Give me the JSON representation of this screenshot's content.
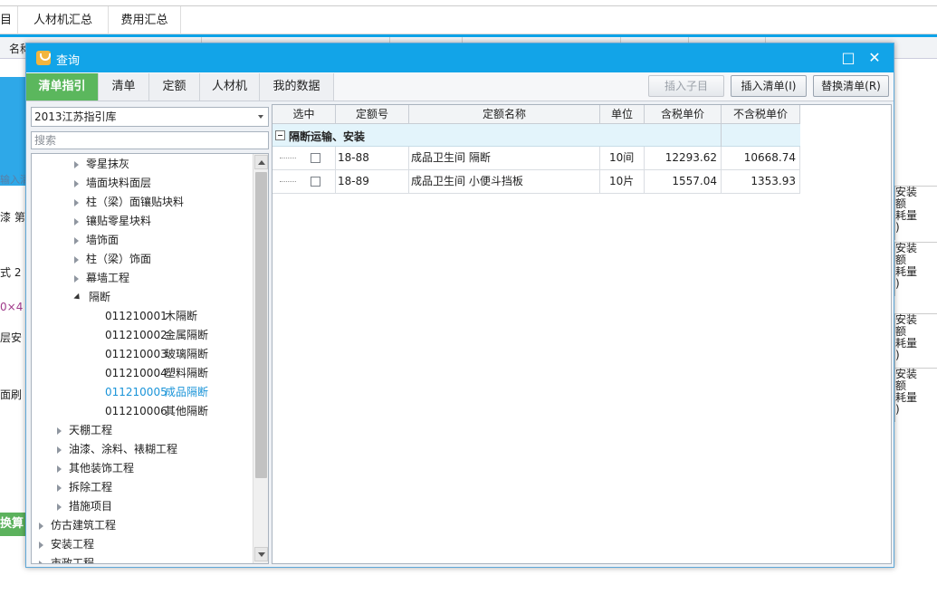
{
  "background": {
    "tabs": [
      "目",
      "人材机汇总",
      "费用汇总"
    ],
    "header_col": "名称",
    "side_texts": [
      "输入清",
      "漆 第",
      "式 2",
      "0×4",
      "层安",
      "面刷",
      "换算"
    ],
    "right_cell": "安装\n额\n耗量\n)"
  },
  "dialog": {
    "title": "查询",
    "tabs": [
      "清单指引",
      "清单",
      "定额",
      "人材机",
      "我的数据"
    ],
    "buttons": {
      "insert_child": "插入子目",
      "insert_list": "插入清单(I)",
      "replace_list": "替换清单(R)"
    },
    "library_select": "2013江苏指引库",
    "search_placeholder": "搜索",
    "tree": [
      {
        "label": "零星抹灰",
        "level": 3,
        "state": "collapsed"
      },
      {
        "label": "墙面块料面层",
        "level": 3,
        "state": "collapsed"
      },
      {
        "label": "柱（梁）面镶贴块料",
        "level": 3,
        "state": "collapsed"
      },
      {
        "label": "镶贴零星块料",
        "level": 3,
        "state": "collapsed"
      },
      {
        "label": "墙饰面",
        "level": 3,
        "state": "collapsed"
      },
      {
        "label": "柱（梁）饰面",
        "level": 3,
        "state": "collapsed"
      },
      {
        "label": "幕墙工程",
        "level": 3,
        "state": "collapsed"
      },
      {
        "label": "隔断",
        "level": 3,
        "state": "expanded"
      },
      {
        "code": "011210001",
        "label": "木隔断",
        "level": 4
      },
      {
        "code": "011210002",
        "label": "金属隔断",
        "level": 4
      },
      {
        "code": "011210003",
        "label": "玻璃隔断",
        "level": 4
      },
      {
        "code": "011210004",
        "label": "塑料隔断",
        "level": 4
      },
      {
        "code": "011210005",
        "label": "成品隔断",
        "level": 4,
        "selected": true
      },
      {
        "code": "011210006",
        "label": "其他隔断",
        "level": 4
      },
      {
        "label": "天棚工程",
        "level": 2,
        "state": "collapsed"
      },
      {
        "label": "油漆、涂料、裱糊工程",
        "level": 2,
        "state": "collapsed"
      },
      {
        "label": "其他装饰工程",
        "level": 2,
        "state": "collapsed"
      },
      {
        "label": "拆除工程",
        "level": 2,
        "state": "collapsed"
      },
      {
        "label": "措施项目",
        "level": 2,
        "state": "collapsed"
      },
      {
        "label": "仿古建筑工程",
        "level": 1,
        "state": "collapsed"
      },
      {
        "label": "安装工程",
        "level": 1,
        "state": "collapsed"
      },
      {
        "label": "市政工程",
        "level": 1,
        "state": "collapsed"
      }
    ],
    "table": {
      "headers": [
        "选中",
        "定额号",
        "定额名称",
        "单位",
        "含税单价",
        "不含税单价"
      ],
      "group": "隔断运输、安装",
      "rows": [
        {
          "code": "18-88",
          "name": "成品卫生间 隔断",
          "unit": "10间",
          "price_tax": "12293.62",
          "price_notax": "10668.74"
        },
        {
          "code": "18-89",
          "name": "成品卫生间 小便斗挡板",
          "unit": "10片",
          "price_tax": "1557.04",
          "price_notax": "1353.93"
        }
      ]
    }
  }
}
